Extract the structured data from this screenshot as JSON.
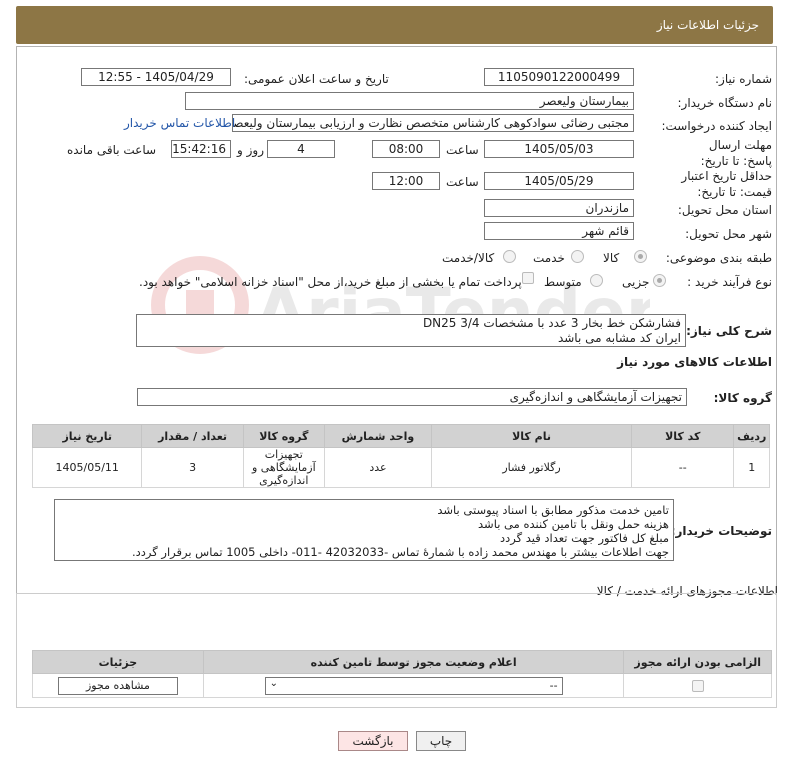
{
  "header": {
    "title": "جزئیات اطلاعات نیاز"
  },
  "labels": {
    "need_number": "شماره نیاز:",
    "announce_date": "تاریخ و ساعت اعلان عمومی:",
    "buyer_org": "نام دستگاه خریدار:",
    "requester": "ایجاد کننده درخواست:",
    "reply_deadline": "مهلت ارسال پاسخ: تا تاریخ:",
    "price_validity": "حداقل تاریخ اعتبار قیمت: تا تاریخ:",
    "time": "ساعت",
    "day_and": "روز و",
    "remaining": "ساعت باقی مانده",
    "province": "استان محل تحویل:",
    "city": "شهر محل تحویل:",
    "category": "طبقه بندی موضوعی:",
    "process": "نوع فرآیند خرید :",
    "description": "شرح کلی نیاز:",
    "goods_info": "اطلاعات کالاهای مورد نیاز",
    "goods_group": "گروه کالا:",
    "buyer_notes": "توضیحات خریدار:",
    "permits_info": "اطلاعات مجوزهای ارائه خدمت / کالا"
  },
  "values": {
    "need_number": "1105090122000499",
    "announce_datetime": "1405/04/29 - 12:55",
    "buyer_org": "بیمارستان ولیعصر",
    "requester": "مجتبی رضائی سوادکوهی کارشناس متخصص نظارت و ارزیابی بیمارستان ولیعصر",
    "contact_link": "اطلاعات تماس خریدار",
    "reply_date": "1405/05/03",
    "reply_time": "08:00",
    "reply_days": "4",
    "reply_remaining": "15:42:16",
    "validity_date": "1405/05/29",
    "validity_time": "12:00",
    "province": "مازندران",
    "city": "قائم شهر",
    "description_line1": "فشارشکن  خط بخار 3 عدد با مشخصات DN25 3/4",
    "description_line2": "ایران کد مشابه می باشد",
    "goods_group": "تجهیزات آزمایشگاهی و اندازه‌گیری"
  },
  "category_options": [
    "کالا",
    "خدمت",
    "کالا/خدمت"
  ],
  "process_options": [
    "جزیی",
    "متوسط"
  ],
  "process_note": "پرداخت تمام یا بخشی از مبلغ خرید،از محل \"اسناد خزانه اسلامی\" خواهد بود.",
  "goods_table": {
    "headers": [
      "ردیف",
      "کد کالا",
      "نام کالا",
      "واحد شمارش",
      "گروه کالا",
      "تعداد / مقدار",
      "تاریخ نیاز"
    ],
    "rows": [
      [
        "1",
        "--",
        "رگلاتور فشار",
        "عدد",
        "تجهیزات آزمایشگاهی و اندازه‌گیری",
        "3",
        "1405/05/11"
      ]
    ]
  },
  "buyer_notes": {
    "line1": "تامین خدمت مذکور مطابق با اسناد پیوستی باشد",
    "line2": "هزینه حمل ونقل با تامین کننده می باشد",
    "line3": "مبلغ کل  فاکتور جهت تعداد قید گردد",
    "line4": "جهت اطلاعات بیشتر با مهندس محمد زاده با شمارهٔ تماس -42032033 -011- داخلی 1005 تماس برقرار گردد."
  },
  "permits_table": {
    "headers": [
      "الزامی بودن ارائه مجوز",
      "اعلام وضعیت مجوز توسط تامین کننده",
      "جزئیات"
    ],
    "select_value": "--",
    "view_button": "مشاهده مجوز"
  },
  "buttons": {
    "print": "چاپ",
    "back": "بازگشت"
  },
  "watermark": "AriaTender.net"
}
